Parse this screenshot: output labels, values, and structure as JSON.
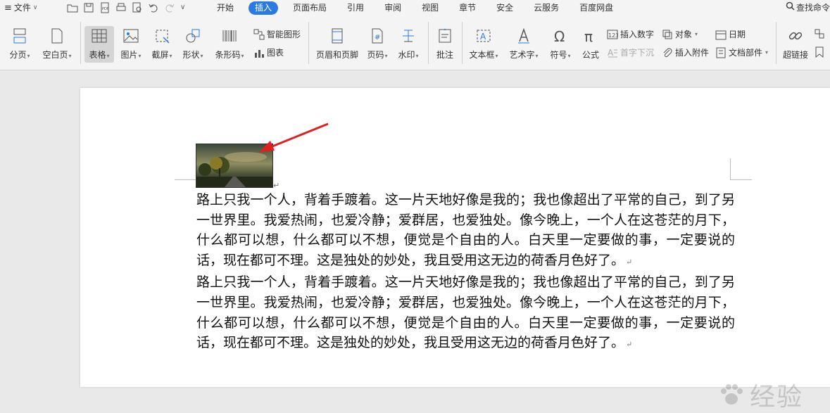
{
  "menubar": {
    "file_label": "文件",
    "tabs": [
      {
        "label": "开始",
        "active": false
      },
      {
        "label": "插入",
        "active": true
      },
      {
        "label": "页面布局",
        "active": false
      },
      {
        "label": "引用",
        "active": false
      },
      {
        "label": "审阅",
        "active": false
      },
      {
        "label": "视图",
        "active": false
      },
      {
        "label": "章节",
        "active": false
      },
      {
        "label": "安全",
        "active": false
      },
      {
        "label": "云服务",
        "active": false
      },
      {
        "label": "百度网盘",
        "active": false
      }
    ],
    "search_label": "查找命令"
  },
  "ribbon": {
    "page_break": "分页",
    "blank_page": "空白页",
    "table": "表格",
    "picture": "图片",
    "screenshot": "截屏",
    "shape": "形状",
    "barcode": "条形码",
    "smart_shape": "智能图形",
    "chart": "图表",
    "header_footer": "页眉和页脚",
    "page_number": "页码",
    "watermark": "水印",
    "comment": "批注",
    "text_box": "文本框",
    "art_text": "艺术字",
    "symbol": "符号",
    "formula": "公式",
    "insert_number": "插入数字",
    "drop_cap": "首字下沉",
    "object": "对象",
    "attachment": "插入附件",
    "date": "日期",
    "doc_parts": "文档部件",
    "hyperlink": "超链接"
  },
  "document": {
    "paragraphs": [
      "路上只我一个人，背着手踱着。这一片天地好像是我的；我也像超出了平常的自己，到了另一世界里。我爱热闹，也爱冷静；爱群居，也爱独处。像今晚上，一个人在这苍茫的月下，什么都可以想，什么都可以不想，便觉是个自由的人。白天里一定要做的事，一定要说的话，现在都可不理。这是独处的妙处，我且受用这无边的荷香月色好了。",
      "路上只我一个人，背着手踱着。这一片天地好像是我的；我也像超出了平常的自己，到了另一世界里。我爱热闹，也爱冷静；爱群居，也爱独处。像今晚上，一个人在这苍茫的月下，什么都可以想，什么都可以不想，便觉是个自由的人。白天里一定要做的事，一定要说的话，现在都可不理。这是独处的妙处，我且受用这无边的荷香月色好了。"
    ],
    "paragraph_mark": "↵"
  },
  "watermark_text": "经验",
  "colors": {
    "active_tab": "#2a7ae2",
    "arrow": "#e02020"
  }
}
